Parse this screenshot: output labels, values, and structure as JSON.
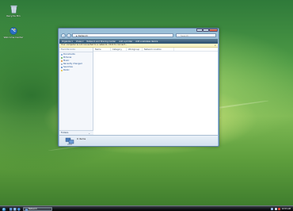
{
  "desktop": {
    "icons": [
      {
        "name": "recycle-bin",
        "label": "Recycle Bin",
        "icon": "recycle-bin-icon"
      },
      {
        "name": "welcome-center",
        "label": "Welcome Center",
        "icon": "welcome-center-icon"
      }
    ]
  },
  "window": {
    "address": "Network",
    "address_prefix": "▸",
    "search_placeholder": "Search",
    "toolbar": [
      "Organize ▾",
      "Views ▾",
      "Network and Sharing Center",
      "Add a printer",
      "Add a wireless device"
    ],
    "infobar": "Your computer is not connected to a network. Click to connect...",
    "infobar_close": "×",
    "nav_header": "Favorite Links",
    "nav_links": [
      "Documents",
      "Pictures",
      "Music",
      "Recently Changed",
      "Searches",
      "Public"
    ],
    "folders_label": "Folders",
    "folders_chevron": "⌄",
    "columns": [
      "Name",
      "Category",
      "Workgroup",
      "Network location"
    ],
    "details_text": "0 items",
    "colors": {
      "toolbar": "#294e6c",
      "infobar": "#fbf5c8",
      "link": "#1e4f91"
    }
  },
  "taskbar": {
    "task_label": "Network",
    "tray_text": "10:53 AM"
  }
}
